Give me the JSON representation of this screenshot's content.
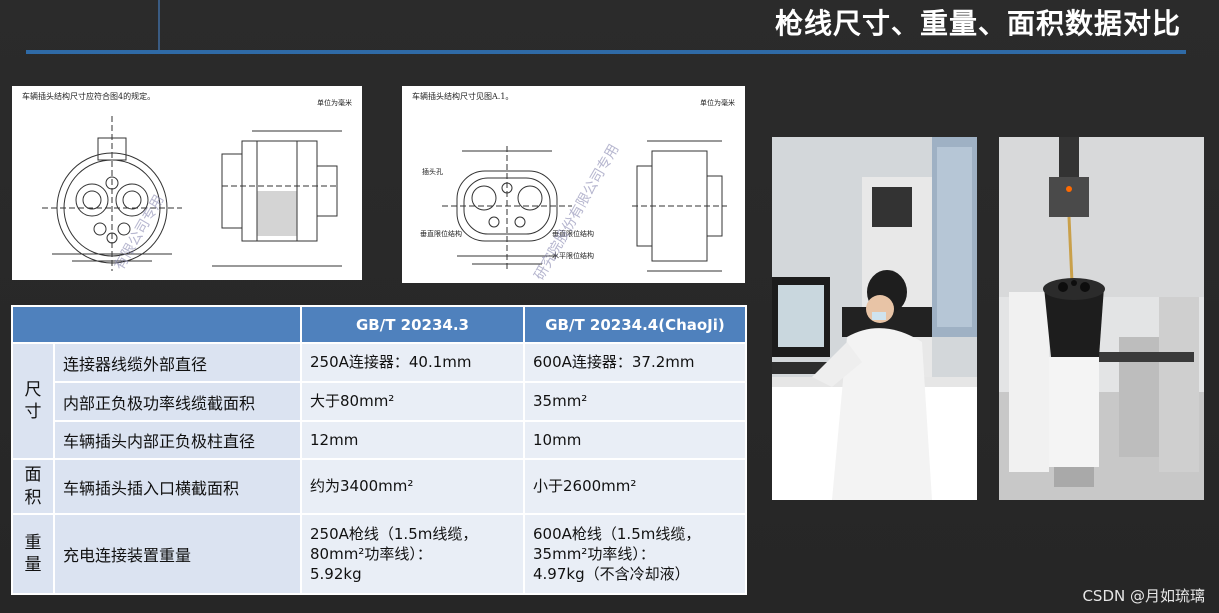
{
  "page": {
    "title": "枪线尺寸、重量、面积数据对比",
    "watermark": "CSDN @月如琉璃"
  },
  "figures": {
    "left": {
      "caption": "车辆插头结构尺寸应符合图4的规定。",
      "unit": "单位为毫米",
      "stamp": "有限公司专用"
    },
    "right": {
      "caption": "车辆插头结构尺寸见图A.1。",
      "unit": "单位为毫米",
      "stamp": "研究院股份有限公司专用",
      "labels": [
        "插头孔",
        "垂直限位结构",
        "垂直限位结构",
        "水平限位结构"
      ]
    }
  },
  "table": {
    "headers": [
      "",
      "GB/T 20234.3",
      "GB/T 20234.4(ChaoJi)"
    ],
    "groups": [
      {
        "category_chars": [
          "尺",
          "寸"
        ],
        "rows": [
          {
            "label": "连接器线缆外部直径",
            "gbt3": "250A连接器：40.1mm",
            "chaoji": "600A连接器：37.2mm"
          },
          {
            "label": "内部正负极功率线缆截面积",
            "gbt3": "大于80mm²",
            "chaoji": "35mm²"
          },
          {
            "label": "车辆插头内部正负极柱直径",
            "gbt3": "12mm",
            "chaoji": "10mm"
          }
        ]
      },
      {
        "category_chars": [
          "面",
          "积"
        ],
        "rows": [
          {
            "label": "车辆插头插入口横截面积",
            "gbt3": "约为3400mm²",
            "chaoji": "小于2600mm²"
          }
        ]
      },
      {
        "category_chars": [
          "重",
          "量"
        ],
        "rows": [
          {
            "label": "充电连接装置重量",
            "gbt3_lines": [
              "250A枪线（1.5m线缆，",
              "80mm²功率线）：",
              "5.92kg"
            ],
            "chaoji_lines": [
              "600A枪线（1.5m线缆，",
              "35mm²功率线）：",
              "4.97kg（不含冷却液）"
            ]
          }
        ]
      }
    ]
  },
  "colors": {
    "header_blue": "#4f81bd",
    "cell_light": "#dbe3f1",
    "title_rule": "#2f6aa6"
  }
}
